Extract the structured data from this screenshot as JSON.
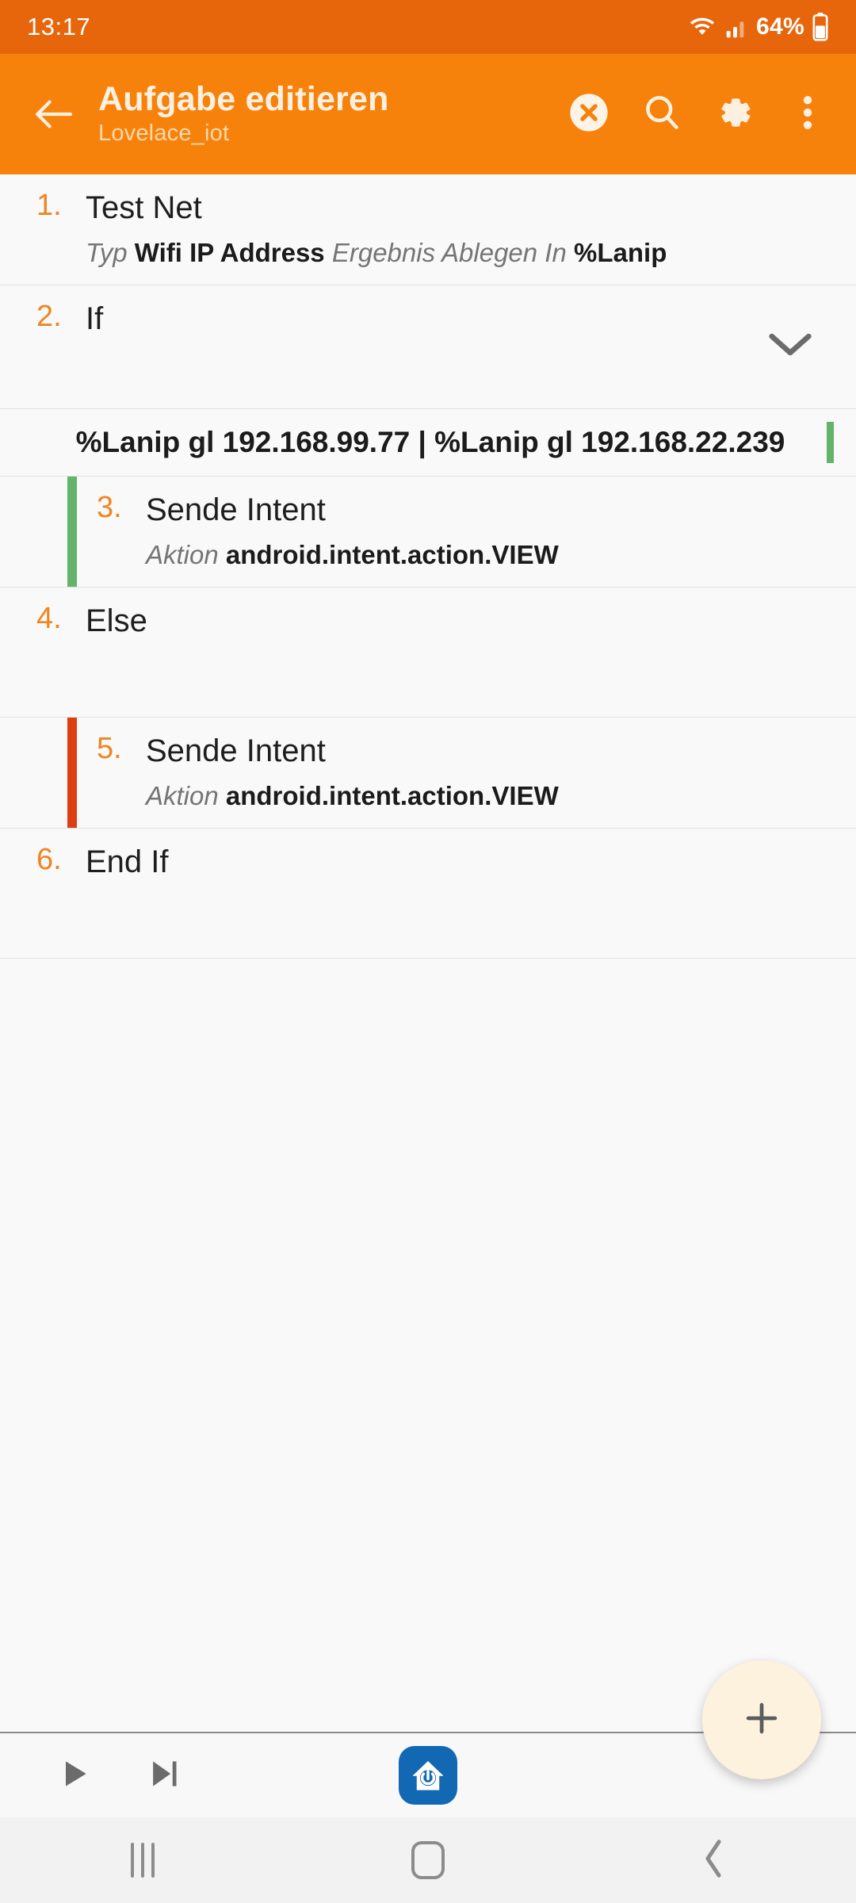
{
  "statusbar": {
    "clock": "13:17",
    "battery_text": "64%",
    "wifi_icon": "wifi-icon",
    "signal_icon": "cellular-signal-icon",
    "battery_icon": "battery-icon"
  },
  "appbar": {
    "back_icon": "back-arrow-icon",
    "title": "Aufgabe editieren",
    "subtitle": "Lovelace_iot",
    "actions": [
      {
        "name": "cancel-button",
        "icon": "close-circle-icon"
      },
      {
        "name": "search-button",
        "icon": "search-icon"
      },
      {
        "name": "settings-button",
        "icon": "gear-icon"
      },
      {
        "name": "overflow-menu-button",
        "icon": "more-vertical-icon"
      }
    ]
  },
  "task_list": {
    "steps": [
      {
        "number": "1.",
        "title": "Test Net",
        "sub_label_1": "Typ",
        "sub_value_1": "Wifi IP Address",
        "sub_label_2": "Ergebnis Ablegen In",
        "sub_value_2": "%Lanip"
      },
      {
        "number": "2.",
        "title": "If",
        "chevron_icon": "chevron-down-icon"
      },
      {
        "condition": "%Lanip gl 192.168.99.77 | %Lanip gl 192.168.22.239",
        "marker_color": "#63b36a"
      },
      {
        "number": "3.",
        "title": "Sende Intent",
        "sub_label_1": "Aktion",
        "sub_value_1": "android.intent.action.VIEW",
        "bar_color": "#63b36a"
      },
      {
        "number": "4.",
        "title": "Else"
      },
      {
        "number": "5.",
        "title": "Sende Intent",
        "sub_label_1": "Aktion",
        "sub_value_1": "android.intent.action.VIEW",
        "bar_color": "#dd3f12"
      },
      {
        "number": "6.",
        "title": "End If"
      }
    ]
  },
  "actionbar": {
    "play_icon": "play-icon",
    "step_icon": "step-forward-icon",
    "app_icon": "home-assistant-icon",
    "fab_icon": "plus-icon"
  },
  "navbar": {
    "recents_icon": "recents-icon",
    "home_icon": "home-icon",
    "back_icon": "back-icon"
  },
  "colors": {
    "statusbar_bg": "#e8660b",
    "appbar_bg": "#f7820b",
    "accent_number": "#ef8521",
    "true_branch": "#63b36a",
    "false_branch": "#dd3f12",
    "fab_bg": "#fdf2de",
    "ha_blue": "#1268b3"
  }
}
